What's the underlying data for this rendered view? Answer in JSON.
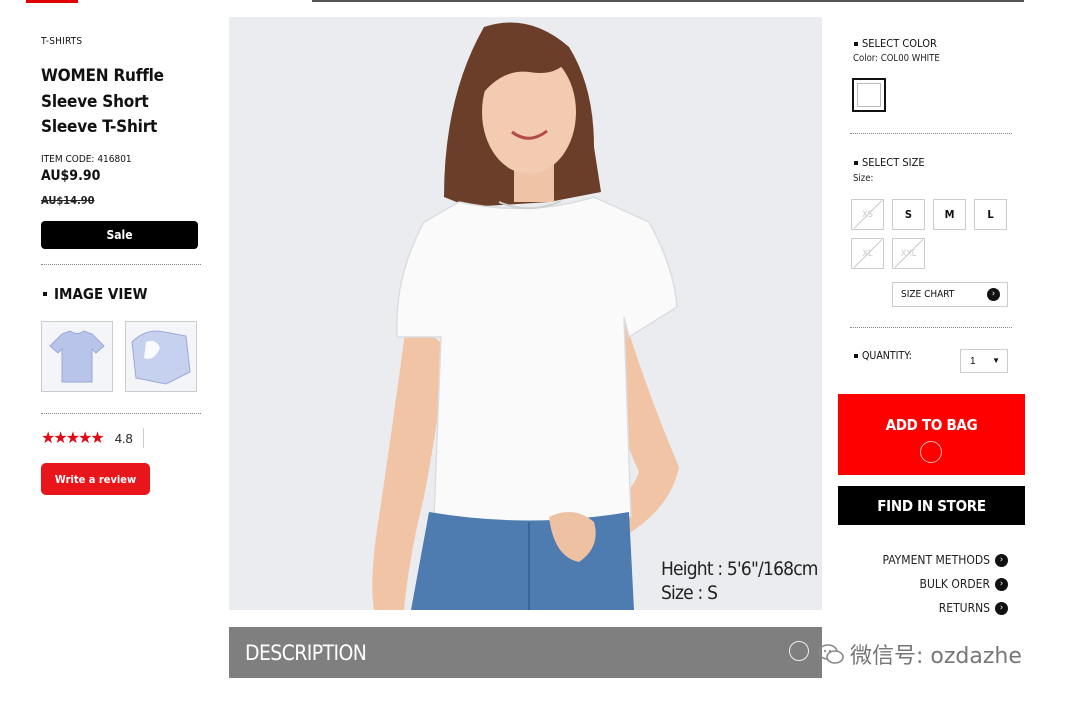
{
  "product": {
    "category": "T-SHIRTS",
    "title": "WOMEN Ruffle Sleeve Short Sleeve T-Shirt",
    "item_code": "ITEM CODE: 416801",
    "price": "AU$9.90",
    "original_price": "AU$14.90",
    "sale_label": "Sale"
  },
  "image_view": {
    "heading": "IMAGE VIEW"
  },
  "rating": {
    "stars": "★★★★★",
    "value": 4.8,
    "value_label": "4.8",
    "review_button": "Write a review"
  },
  "photo": {
    "caption_height": "Height : 5'6\"/168cm",
    "caption_size": "Size : S"
  },
  "description": {
    "label": "DESCRIPTION"
  },
  "color": {
    "heading": "SELECT COLOR",
    "current": "Color: COL00 WHITE"
  },
  "size": {
    "heading": "SELECT SIZE",
    "current": "Size:",
    "options": [
      "XS",
      "S",
      "M",
      "L",
      "XL",
      "XXL"
    ],
    "size_chart_label": "SIZE CHART"
  },
  "quantity": {
    "label": "QUANTITY:",
    "value": "1"
  },
  "actions": {
    "add_to_bag": "ADD TO BAG",
    "find_in_store": "FIND IN STORE"
  },
  "links": {
    "payment": "PAYMENT METHODS",
    "bulk": "BULK ORDER",
    "returns": "RETURNS"
  },
  "watermark": {
    "text": "微信号: ozdazhe"
  },
  "colors": {
    "accent_red": "#ff0000",
    "star_red": "#e30613",
    "dark": "#000000",
    "description_bar": "#7f7f7f"
  }
}
